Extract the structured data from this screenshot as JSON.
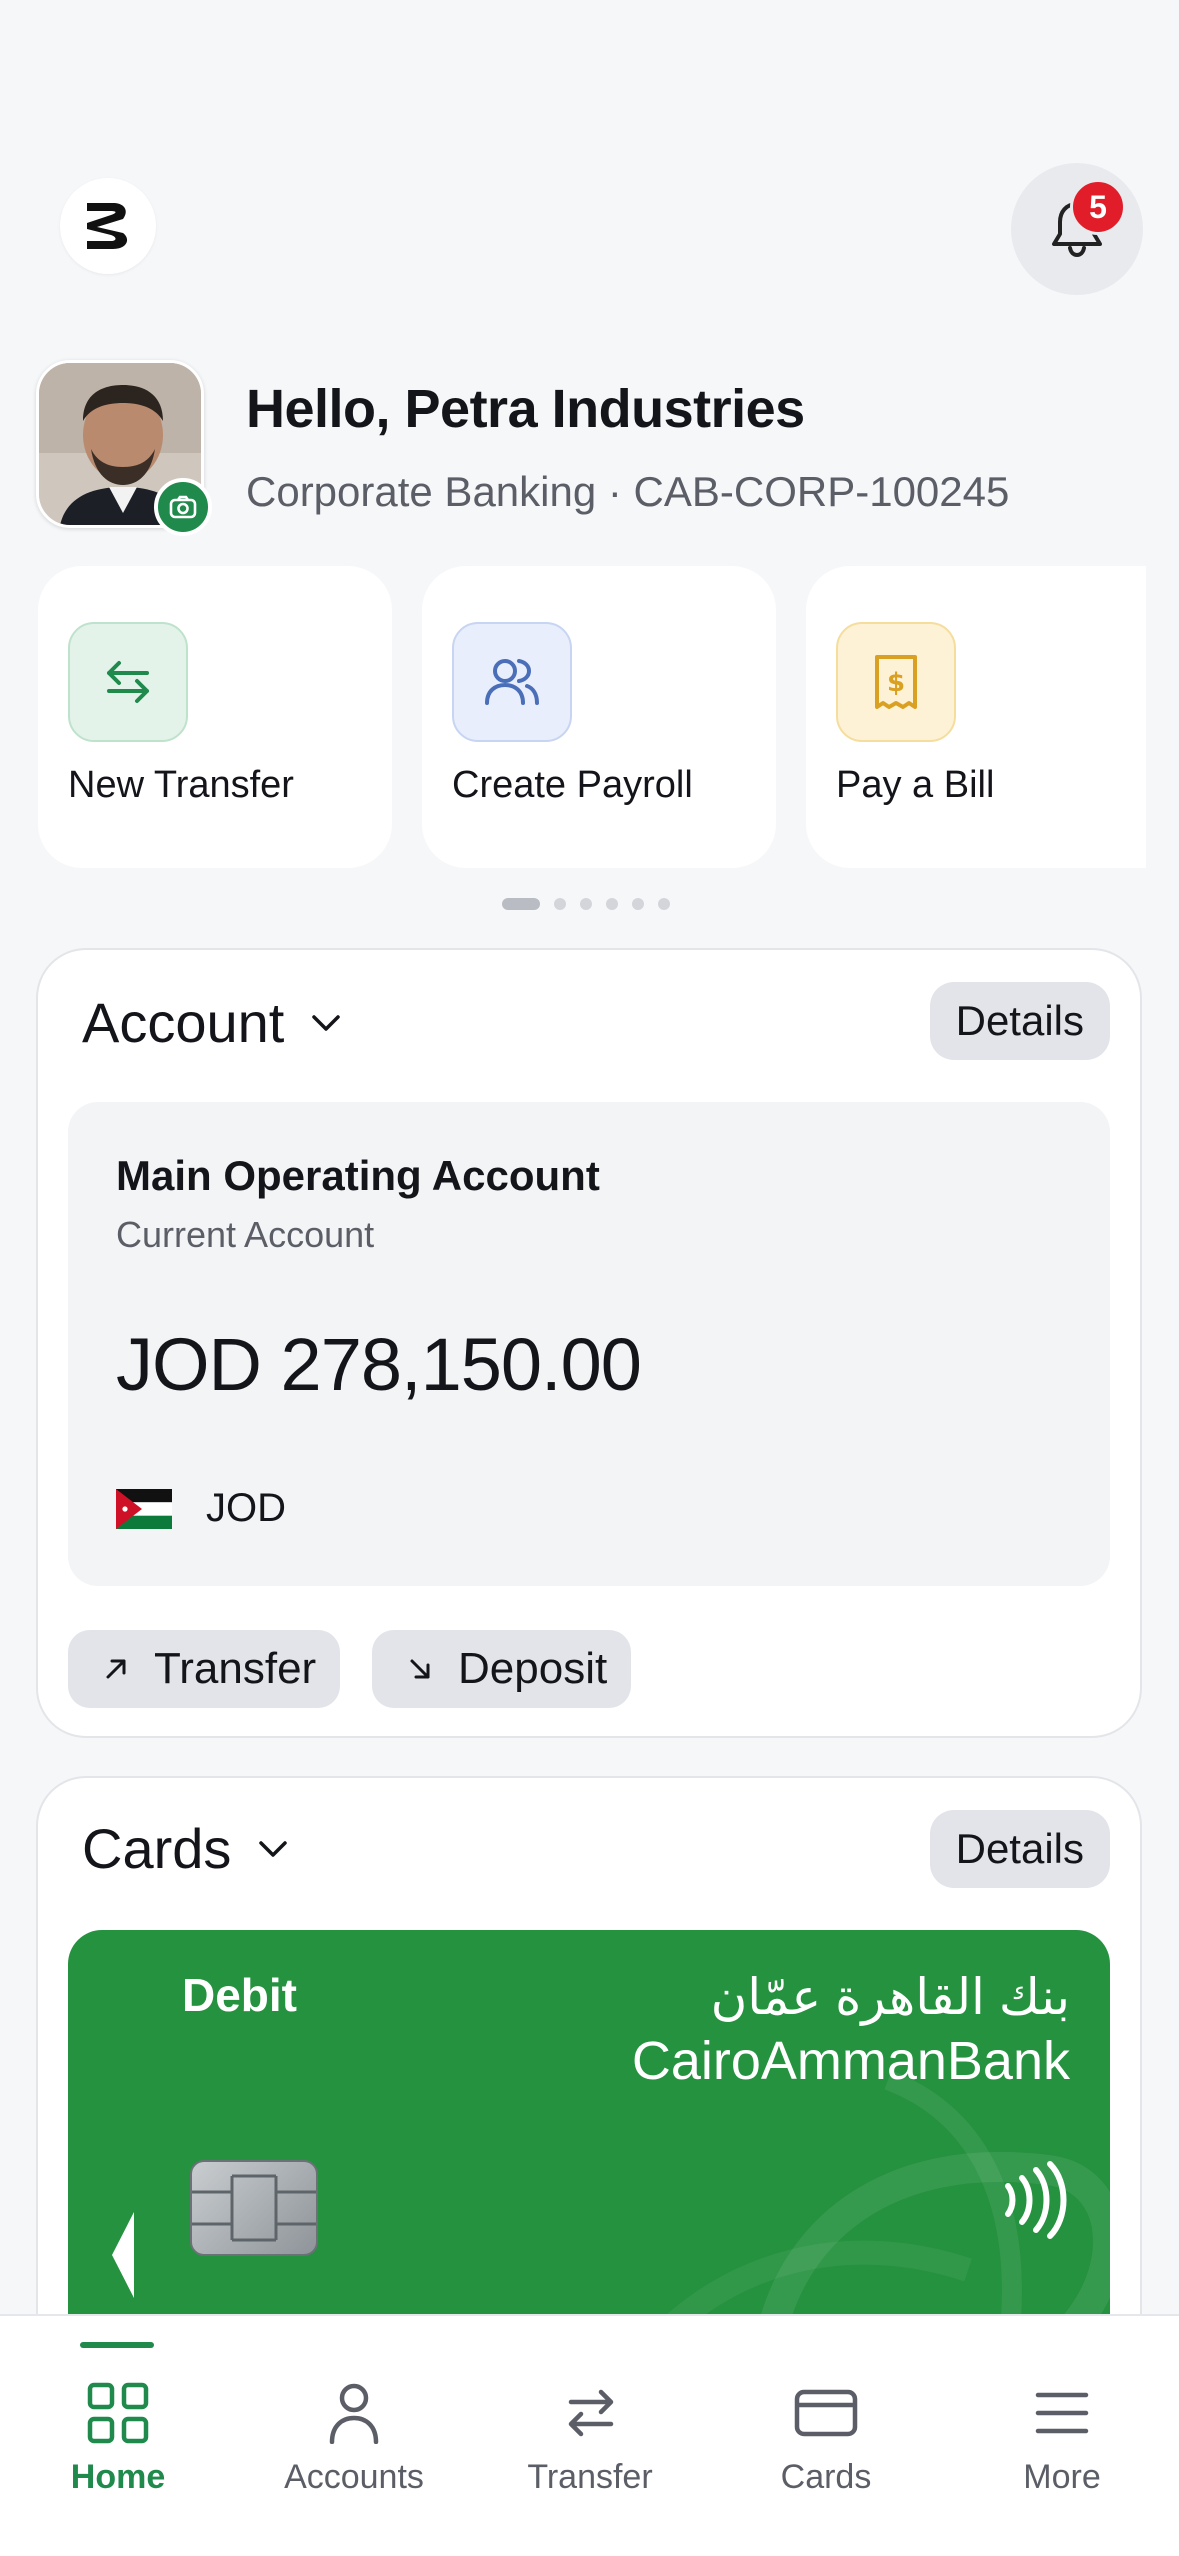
{
  "header": {
    "notification_count": "5"
  },
  "profile": {
    "greeting": "Hello, Petra Industries",
    "subtitle": "Corporate Banking · CAB-CORP-100245"
  },
  "quick_actions": [
    {
      "label": "New Transfer",
      "icon": "transfer-arrows-icon",
      "tint": "#e4f3ea",
      "color": "#1f8a4c"
    },
    {
      "label": "Create Payroll",
      "icon": "users-icon",
      "tint": "#e8eefb",
      "color": "#4a6fb8"
    },
    {
      "label": "Pay a Bill",
      "icon": "bill-icon",
      "tint": "#fdf2d6",
      "color": "#d9a021"
    }
  ],
  "pager": {
    "total": 6,
    "active": 0
  },
  "account_section": {
    "title": "Account",
    "details_label": "Details",
    "account_name": "Main Operating Account",
    "account_type": "Current Account",
    "balance": "JOD 278,150.00",
    "currency": "JOD",
    "transfer_label": "Transfer",
    "deposit_label": "Deposit"
  },
  "cards_section": {
    "title": "Cards",
    "details_label": "Details",
    "card_type": "Debit",
    "bank_name_ar": "بنك القاهرة عمّان",
    "bank_name_en": "CairoAmmanBank",
    "card_color": "#25923f"
  },
  "bottom_nav": [
    {
      "label": "Home",
      "icon": "home-grid-icon",
      "active": true
    },
    {
      "label": "Accounts",
      "icon": "person-icon",
      "active": false
    },
    {
      "label": "Transfer",
      "icon": "transfer-arrows-icon",
      "active": false
    },
    {
      "label": "Cards",
      "icon": "card-icon",
      "active": false
    },
    {
      "label": "More",
      "icon": "menu-icon",
      "active": false
    }
  ],
  "colors": {
    "brand_green": "#1f8a4c",
    "badge_red": "#e11d2a"
  }
}
